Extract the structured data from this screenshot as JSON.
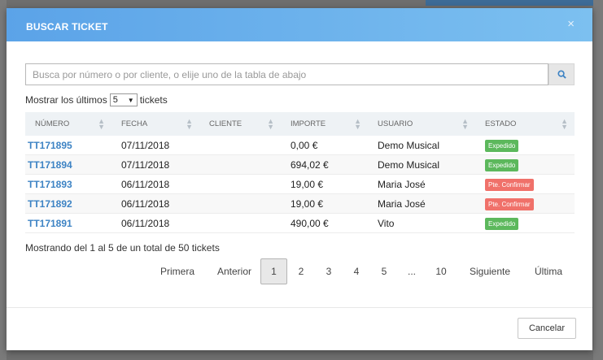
{
  "modal": {
    "title": "BUSCAR TICKET",
    "close_glyph": "×"
  },
  "search": {
    "placeholder": "Busca por número o por cliente, o elije uno de la tabla de abajo",
    "value": "",
    "button_icon": "search-icon"
  },
  "page_size": {
    "prefix": "Mostrar los últimos",
    "value": "5",
    "suffix": "tickets"
  },
  "table": {
    "columns": [
      "NÚMERO",
      "FECHA",
      "CLIENTE",
      "IMPORTE",
      "USUARIO",
      "ESTADO"
    ],
    "rows": [
      {
        "numero": "TT171895",
        "fecha": "07/11/2018",
        "cliente": "",
        "importe": "0,00 €",
        "usuario": "Demo Musical",
        "estado": "Expedido",
        "estado_color": "#5cb85c"
      },
      {
        "numero": "TT171894",
        "fecha": "07/11/2018",
        "cliente": "",
        "importe": "694,02 €",
        "usuario": "Demo Musical",
        "estado": "Expedido",
        "estado_color": "#5cb85c"
      },
      {
        "numero": "TT171893",
        "fecha": "06/11/2018",
        "cliente": "",
        "importe": "19,00 €",
        "usuario": "Maria José",
        "estado": "Pte. Confirmar",
        "estado_color": "#f0716a"
      },
      {
        "numero": "TT171892",
        "fecha": "06/11/2018",
        "cliente": "",
        "importe": "19,00 €",
        "usuario": "Maria José",
        "estado": "Pte. Confirmar",
        "estado_color": "#f0716a"
      },
      {
        "numero": "TT171891",
        "fecha": "06/11/2018",
        "cliente": "",
        "importe": "490,00 €",
        "usuario": "Vito",
        "estado": "Expedido",
        "estado_color": "#5cb85c"
      }
    ]
  },
  "summary": "Mostrando del 1 al 5 de un total de 50 tickets",
  "pagination": {
    "first": "Primera",
    "prev": "Anterior",
    "pages": [
      "1",
      "2",
      "3",
      "4",
      "5",
      "...",
      "10"
    ],
    "active": "1",
    "next": "Siguiente",
    "last": "Última"
  },
  "footer": {
    "cancel_label": "Cancelar"
  },
  "colors": {
    "header_gradient_start": "#5ba3e8",
    "header_gradient_end": "#7cc0f0",
    "link": "#3d83c4",
    "expedido": "#5cb85c",
    "pendiente": "#f0716a"
  }
}
